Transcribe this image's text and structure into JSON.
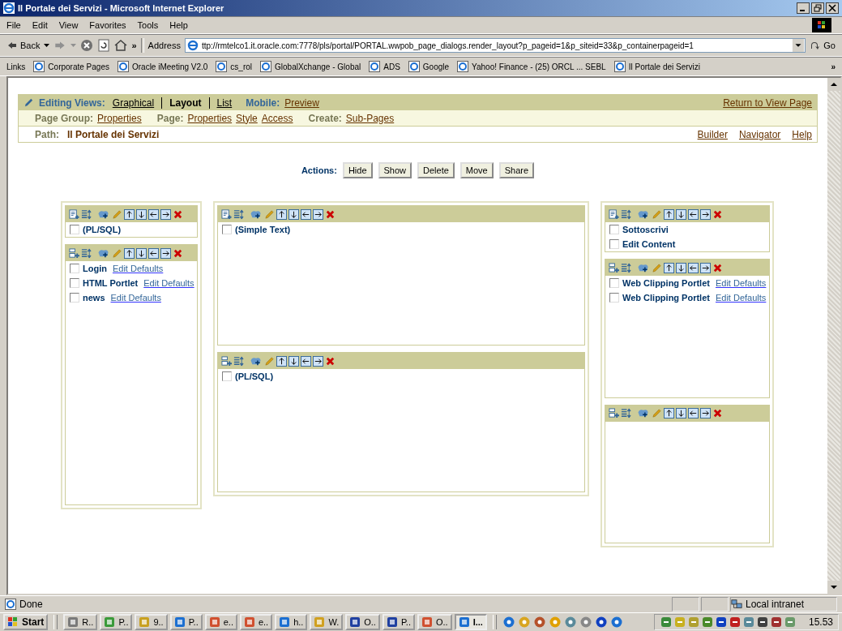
{
  "window": {
    "title": "Il Portale dei Servizi - Microsoft Internet Explorer"
  },
  "menu": [
    "File",
    "Edit",
    "View",
    "Favorites",
    "Tools",
    "Help"
  ],
  "toolbar": {
    "back": "Back",
    "more": "»",
    "address_label": "Address",
    "address": "ttp://rmtelco1.it.oracle.com:7778/pls/portal/PORTAL.wwpob_page_dialogs.render_layout?p_pageid=1&p_siteid=33&p_containerpageid=1",
    "go": "Go"
  },
  "links_bar": {
    "label": "Links",
    "items": [
      "Corporate Pages",
      "Oracle iMeeting V2.0",
      "cs_rol",
      "GlobalXchange - Global",
      "ADS",
      "Google",
      "Yahoo! Finance - (25) ORCL ... SEBL",
      "Il Portale dei Servizi"
    ],
    "more": "»"
  },
  "portal": {
    "views_label": "Editing Views:",
    "views": [
      {
        "label": "Graphical",
        "selected": false
      },
      {
        "label": "Layout",
        "selected": true
      },
      {
        "label": "List",
        "selected": false
      }
    ],
    "mobile_label": "Mobile:",
    "mobile_link": "Preview",
    "return_link": "Return to View Page",
    "groups": [
      {
        "label": "Page Group:",
        "links": [
          "Properties"
        ]
      },
      {
        "label": "Page:",
        "links": [
          "Properties",
          "Style",
          "Access"
        ]
      },
      {
        "label": "Create:",
        "links": [
          "Sub-Pages"
        ]
      }
    ],
    "path_label": "Path:",
    "path": "Il Portale dei Servizi",
    "nav_links": [
      "Builder",
      "Navigator",
      "Help"
    ],
    "actions_label": "Actions:",
    "actions": [
      "Hide",
      "Show",
      "Delete",
      "Move",
      "Share"
    ],
    "columns": [
      {
        "regions": [
          {
            "kind": "item",
            "entries": [
              {
                "name": "(PL/SQL)",
                "checked": false
              }
            ]
          },
          {
            "kind": "portlet",
            "entries": [
              {
                "name": "Login",
                "link": "Edit Defaults",
                "checked": false
              },
              {
                "name": "HTML Portlet",
                "link": "Edit Defaults",
                "checked": false
              },
              {
                "name": "news",
                "link": "Edit Defaults",
                "checked": false
              }
            ]
          }
        ]
      },
      {
        "regions": [
          {
            "kind": "item",
            "entries": [
              {
                "name": "(Simple Text)",
                "checked": false
              }
            ]
          },
          {
            "kind": "portlet",
            "entries": [
              {
                "name": "(PL/SQL)",
                "checked": false
              }
            ]
          }
        ]
      },
      {
        "regions": [
          {
            "kind": "item",
            "entries": [
              {
                "name": "Sottoscrivi",
                "checked": false
              },
              {
                "name": "Edit Content",
                "checked": false
              }
            ]
          },
          {
            "kind": "portlet",
            "entries": [
              {
                "name": "Web Clipping Portlet",
                "link": "Edit Defaults",
                "checked": false
              },
              {
                "name": "Web Clipping Portlet",
                "link": "Edit Defaults",
                "checked": false
              }
            ]
          },
          {
            "kind": "portlet"
          }
        ]
      }
    ]
  },
  "status_bar": {
    "text": "Done",
    "zone": "Local intranet"
  },
  "taskbar": {
    "start": "Start",
    "buttons": [
      {
        "label": "R..",
        "selected": false
      },
      {
        "label": "P..",
        "selected": false
      },
      {
        "label": "9..",
        "selected": false
      },
      {
        "label": "P..",
        "selected": false
      },
      {
        "label": "e..",
        "selected": false
      },
      {
        "label": "e..",
        "selected": false
      },
      {
        "label": "h..",
        "selected": false
      },
      {
        "label": "W.",
        "selected": false
      },
      {
        "label": "O..",
        "selected": false
      },
      {
        "label": "P..",
        "selected": false
      },
      {
        "label": "O..",
        "selected": false
      },
      {
        "label": "I...",
        "selected": true
      }
    ],
    "clock": "15.53"
  }
}
